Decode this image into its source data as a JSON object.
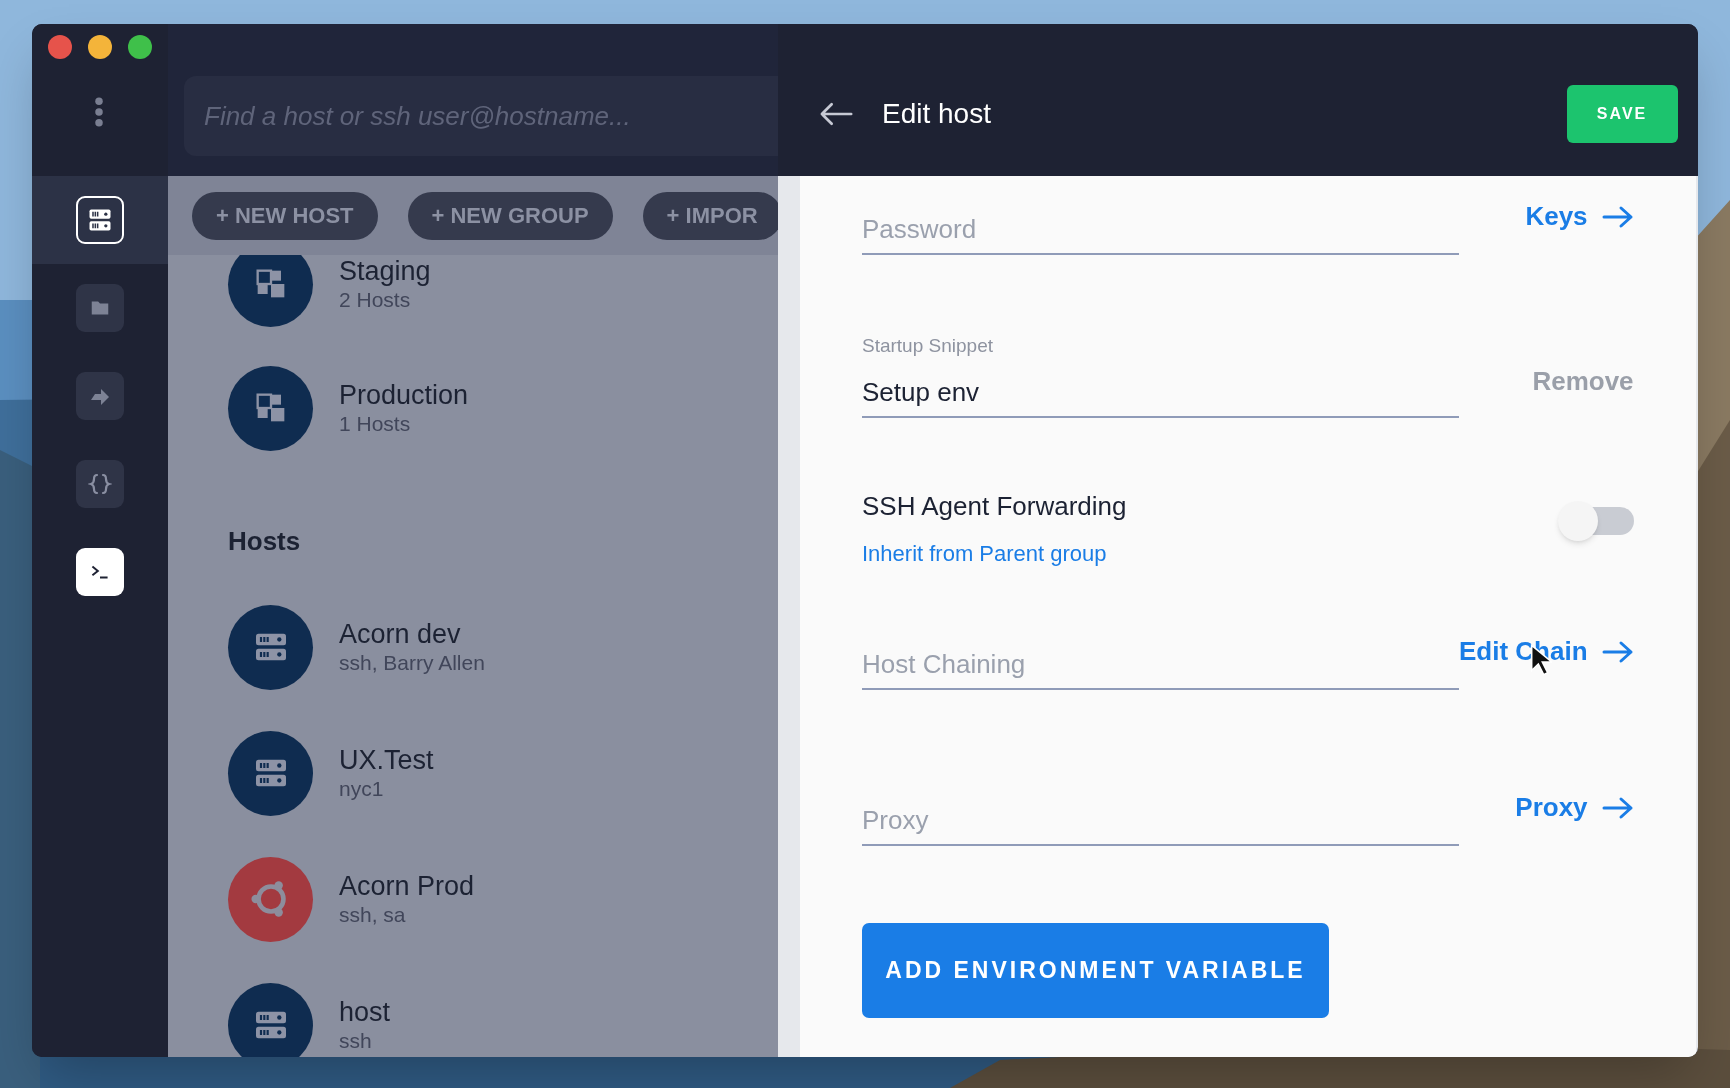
{
  "sidebar": {
    "items": [
      {
        "kind": "hosts",
        "selected": true
      },
      {
        "kind": "folder",
        "selected": false
      },
      {
        "kind": "forward",
        "selected": false
      },
      {
        "kind": "snippets",
        "selected": false
      },
      {
        "kind": "terminal",
        "selected": false
      }
    ]
  },
  "search": {
    "placeholder": "Find a host or ssh user@hostname..."
  },
  "toolbar": {
    "buttons": [
      "+ NEW HOST",
      "+ NEW GROUP",
      "+ IMPOR"
    ]
  },
  "groups": [
    {
      "name": "Staging",
      "detail": "2 Hosts"
    },
    {
      "name": "Production",
      "detail": "1 Hosts"
    }
  ],
  "hosts_heading": "Hosts",
  "hosts": [
    {
      "name": "Acorn dev",
      "detail": "ssh, Barry Allen",
      "kind": "server",
      "color": "#0f2c50"
    },
    {
      "name": "UX.Test",
      "detail": "nyc1",
      "kind": "server",
      "color": "#0f2c50"
    },
    {
      "name": "Acorn Prod",
      "detail": "ssh, sa",
      "kind": "ubuntu",
      "color": "#a33a40"
    },
    {
      "name": "host",
      "detail": "ssh",
      "kind": "server",
      "color": "#0f2c50"
    }
  ],
  "editor": {
    "title": "Edit host",
    "save": "SAVE",
    "fields": [
      {
        "kind": "input",
        "placeholder": "Password",
        "link": "Keys"
      },
      {
        "kind": "snippet",
        "label": "Startup Snippet",
        "value": "Setup env",
        "action": "Remove"
      },
      {
        "kind": "toggle",
        "label": "SSH Agent Forwarding",
        "on": false,
        "link": "Inherit from Parent group"
      },
      {
        "kind": "input",
        "placeholder": "Host Chaining",
        "link": "Edit Chain"
      },
      {
        "kind": "input",
        "placeholder": "Proxy",
        "link": "Proxy"
      }
    ],
    "add_button": "ADD ENVIRONMENT VARIABLE"
  }
}
